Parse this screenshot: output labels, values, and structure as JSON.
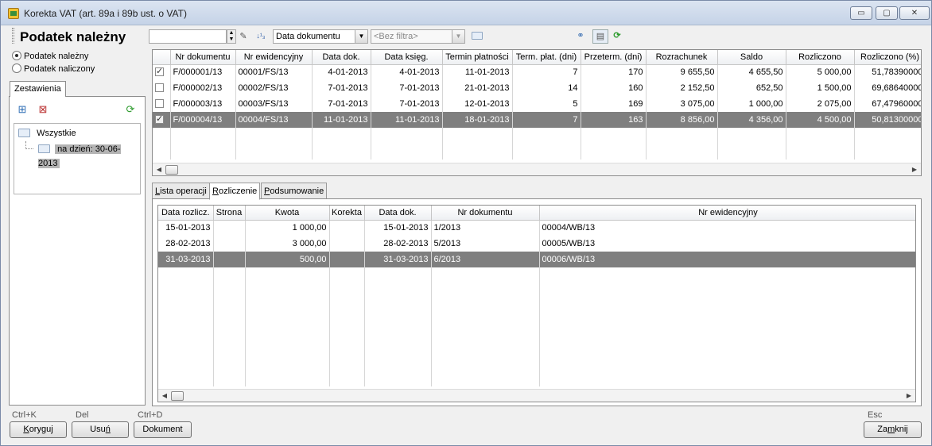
{
  "window": {
    "title": "Korekta VAT (art. 89a i 89b ust. o VAT)"
  },
  "toolbar": {
    "page_title": "Podatek należny",
    "search_value": "",
    "date_select": "Data dokumentu",
    "filter_select": "<Bez filtra>"
  },
  "left": {
    "radio_nalezny": "Podatek należny",
    "radio_naliczony": "Podatek naliczony",
    "selected_radio": "Podatek należny",
    "tab_label": "Zestawienia",
    "tree": {
      "root": "Wszystkie",
      "child": "na dzień: 30-06-2013"
    }
  },
  "top_grid": {
    "columns": [
      "Nr dokumentu",
      "Nr ewidencyjny",
      "Data dok.",
      "Data księg.",
      "Termin płatności",
      "Term. płat. (dni)",
      "Przeterm. (dni)",
      "Rozrachunek",
      "Saldo",
      "Rozliczono",
      "Rozliczono (%)"
    ],
    "rows": [
      {
        "checked": true,
        "nr_dok": "F/000001/13",
        "nr_ew": "00001/FS/13",
        "data_dok": "4-01-2013",
        "data_ksieg": "4-01-2013",
        "termin": "11-01-2013",
        "term_dni": "7",
        "przeterm": "170",
        "rozrachunek": "9 655,50",
        "saldo": "4 655,50",
        "rozliczono": "5 000,00",
        "procent": "51,78390000",
        "selected": false
      },
      {
        "checked": false,
        "nr_dok": "F/000002/13",
        "nr_ew": "00002/FS/13",
        "data_dok": "7-01-2013",
        "data_ksieg": "7-01-2013",
        "termin": "21-01-2013",
        "term_dni": "14",
        "przeterm": "160",
        "rozrachunek": "2 152,50",
        "saldo": "652,50",
        "rozliczono": "1 500,00",
        "procent": "69,68640000",
        "selected": false
      },
      {
        "checked": false,
        "nr_dok": "F/000003/13",
        "nr_ew": "00003/FS/13",
        "data_dok": "7-01-2013",
        "data_ksieg": "7-01-2013",
        "termin": "12-01-2013",
        "term_dni": "5",
        "przeterm": "169",
        "rozrachunek": "3 075,00",
        "saldo": "1 000,00",
        "rozliczono": "2 075,00",
        "procent": "67,47960000",
        "selected": false
      },
      {
        "checked": true,
        "nr_dok": "F/000004/13",
        "nr_ew": "00004/FS/13",
        "data_dok": "11-01-2013",
        "data_ksieg": "11-01-2013",
        "termin": "18-01-2013",
        "term_dni": "7",
        "przeterm": "163",
        "rozrachunek": "8 856,00",
        "saldo": "4 356,00",
        "rozliczono": "4 500,00",
        "procent": "50,81300000",
        "selected": true
      }
    ]
  },
  "tabs": [
    {
      "label_pre": "",
      "label_u": "L",
      "label_post": "ista operacji",
      "active": false
    },
    {
      "label_pre": "",
      "label_u": "R",
      "label_post": "ozliczenie",
      "active": true
    },
    {
      "label_pre": "",
      "label_u": "P",
      "label_post": "odsumowanie",
      "active": false
    }
  ],
  "bottom_grid": {
    "columns": [
      "Data rozlicz.",
      "Strona",
      "Kwota",
      "Korekta",
      "Data dok.",
      "Nr dokumentu",
      "Nr ewidencyjny"
    ],
    "rows": [
      {
        "data_rozl": "15-01-2013",
        "strona": "",
        "kwota": "1 000,00",
        "korekta": "",
        "data_dok": "15-01-2013",
        "nr_dok": "1/2013",
        "nr_ew": "00004/WB/13",
        "selected": false
      },
      {
        "data_rozl": "28-02-2013",
        "strona": "",
        "kwota": "3 000,00",
        "korekta": "",
        "data_dok": "28-02-2013",
        "nr_dok": "5/2013",
        "nr_ew": "00005/WB/13",
        "selected": false
      },
      {
        "data_rozl": "31-03-2013",
        "strona": "",
        "kwota": "500,00",
        "korekta": "",
        "data_dok": "31-03-2013",
        "nr_dok": "6/2013",
        "nr_ew": "00006/WB/13",
        "selected": true
      }
    ]
  },
  "footer": {
    "koryguj": {
      "shortcut": "Ctrl+K",
      "label_u": "K",
      "label_rest": "oryguj"
    },
    "usun": {
      "shortcut": "Del",
      "label_pre": "Usu",
      "label_u": "ń",
      "label_rest": ""
    },
    "dokument": {
      "shortcut": "Ctrl+D",
      "label": "Dokument"
    },
    "zamknij": {
      "shortcut": "Esc",
      "label_pre": "Za",
      "label_u": "m",
      "label_rest": "knij"
    }
  },
  "colors": {
    "selected_row": "#7f7f7f",
    "window_bg": "#f0f0f0",
    "titlebar": "#c5d3e7"
  }
}
